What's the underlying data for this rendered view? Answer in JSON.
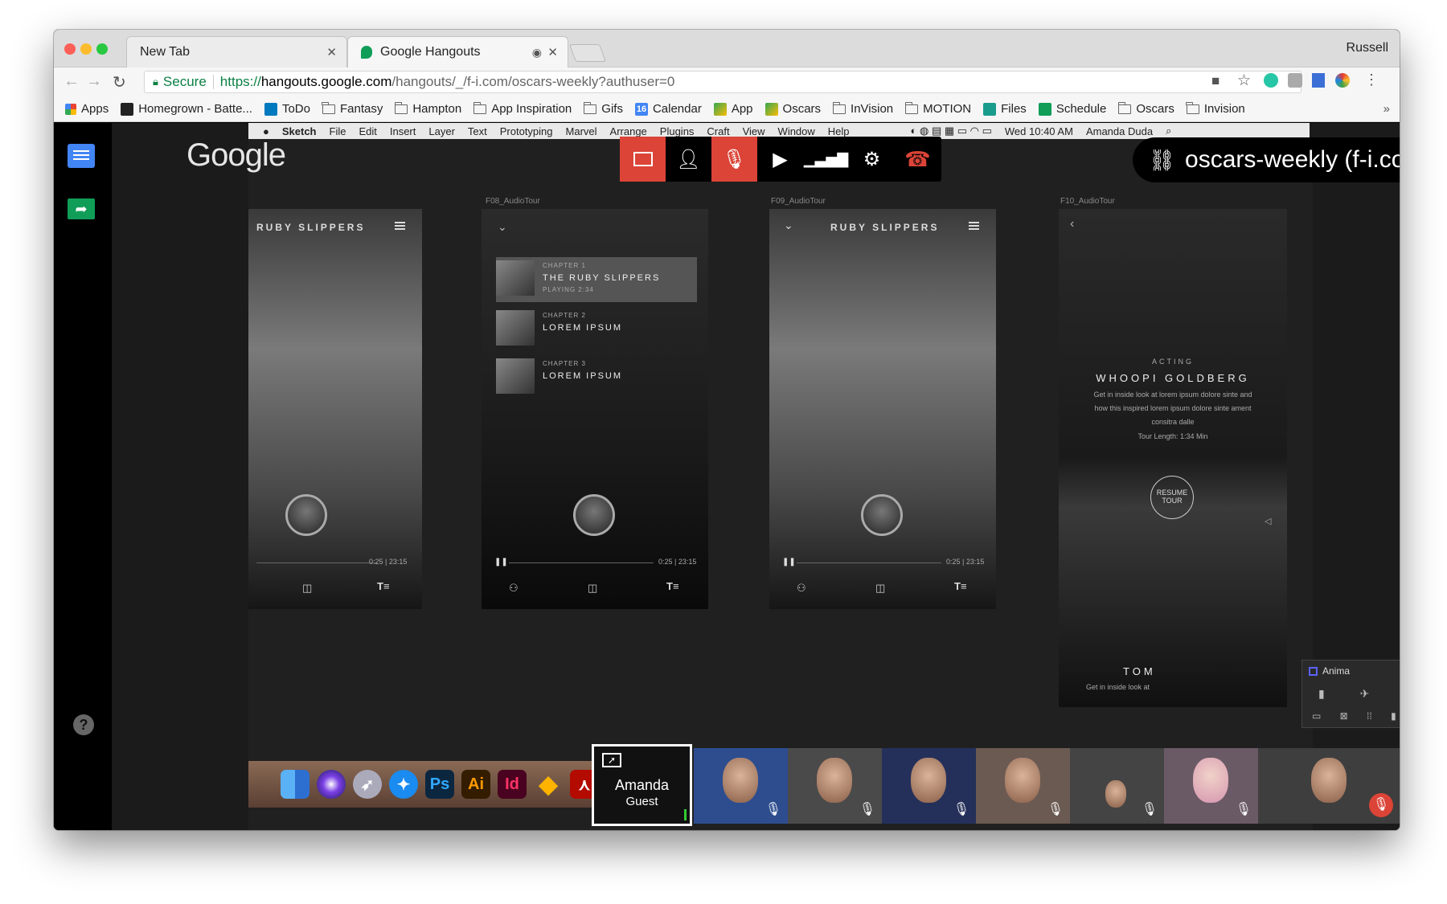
{
  "browser": {
    "tabs": [
      {
        "title": "New Tab"
      },
      {
        "title": "Google Hangouts"
      }
    ],
    "profile": "Russell",
    "secure_label": "Secure",
    "url": {
      "scheme": "https://",
      "host": "hangouts.google.com",
      "path": "/hangouts/_/f-i.com/oscars-weekly?authuser=0"
    },
    "bookmarks": [
      {
        "label": "Apps",
        "icon": "apps-grid-icon"
      },
      {
        "label": "Homegrown - Batte...",
        "icon": "page-icon"
      },
      {
        "label": "ToDo",
        "icon": "trello-icon"
      },
      {
        "label": "Fantasy",
        "icon": "folder-icon"
      },
      {
        "label": "Hampton",
        "icon": "folder-icon"
      },
      {
        "label": "App Inspiration",
        "icon": "folder-icon"
      },
      {
        "label": "Gifs",
        "icon": "folder-icon"
      },
      {
        "label": "Calendar",
        "icon": "calendar-icon"
      },
      {
        "label": "App",
        "icon": "drive-icon"
      },
      {
        "label": "Oscars",
        "icon": "drive-icon"
      },
      {
        "label": "InVision",
        "icon": "folder-icon"
      },
      {
        "label": "MOTION",
        "icon": "folder-icon"
      },
      {
        "label": "Files",
        "icon": "files-icon"
      },
      {
        "label": "Schedule",
        "icon": "sheets-icon"
      },
      {
        "label": "Oscars",
        "icon": "folder-icon"
      },
      {
        "label": "Invision",
        "icon": "folder-icon"
      }
    ],
    "overflow": "»"
  },
  "mac_menu": {
    "items": [
      "Sketch",
      "File",
      "Edit",
      "Insert",
      "Layer",
      "Text",
      "Prototyping",
      "Marvel",
      "Arrange",
      "Plugins",
      "Craft",
      "View",
      "Window",
      "Help"
    ],
    "clock": "Wed 10:40 AM",
    "user": "Amanda Duda"
  },
  "hangouts": {
    "logo": "Google",
    "controls": [
      {
        "name": "present-icon",
        "active": true
      },
      {
        "name": "add-person-icon",
        "active": false
      },
      {
        "name": "mic-off-icon",
        "active": true
      },
      {
        "name": "camera-off-icon",
        "active": false
      },
      {
        "name": "signal-icon",
        "active": false
      },
      {
        "name": "settings-icon",
        "active": false
      },
      {
        "name": "hang-up-icon",
        "active": false
      }
    ],
    "link_label": "oscars-weekly (f-i.com)",
    "self_tile": {
      "name": "Amanda",
      "role": "Guest"
    }
  },
  "sketch": {
    "artboards": [
      {
        "label": "",
        "title": "RUBY SLIPPERS",
        "time": "0:25 | 23:15"
      },
      {
        "label": "F08_AudioTour",
        "title": "",
        "time": "0:25 | 23:15",
        "chapters": [
          {
            "chapter": "CHAPTER 1",
            "name": "THE RUBY SLIPPERS",
            "sub": "PLAYING 2:34"
          },
          {
            "chapter": "CHAPTER 2",
            "name": "LOREM IPSUM",
            "sub": ""
          },
          {
            "chapter": "CHAPTER 3",
            "name": "LOREM IPSUM",
            "sub": ""
          }
        ]
      },
      {
        "label": "F09_AudioTour",
        "title": "RUBY SLIPPERS",
        "time": "0:25 | 23:15"
      },
      {
        "label": "F10_AudioTour",
        "title": "",
        "acting": "ACTING",
        "name": "WHOOPI GOLDBERG",
        "desc1": "Get in inside look at lorem ipsum dolore sinte and",
        "desc2": "how this inspired lorem ipsum dolore sinte ament",
        "desc3": "consitra dalle",
        "length": "Tour Length: 1:34 Min",
        "resume": "RESUME",
        "tour": "TOUR",
        "second_name": "TOM",
        "second_desc": "Get in inside look at"
      }
    ],
    "anima_title": "Anima"
  },
  "dock": [
    "finder",
    "siri",
    "launchpad",
    "safari",
    "Ps",
    "Ai",
    "Id",
    "sketch",
    "acrobat"
  ]
}
